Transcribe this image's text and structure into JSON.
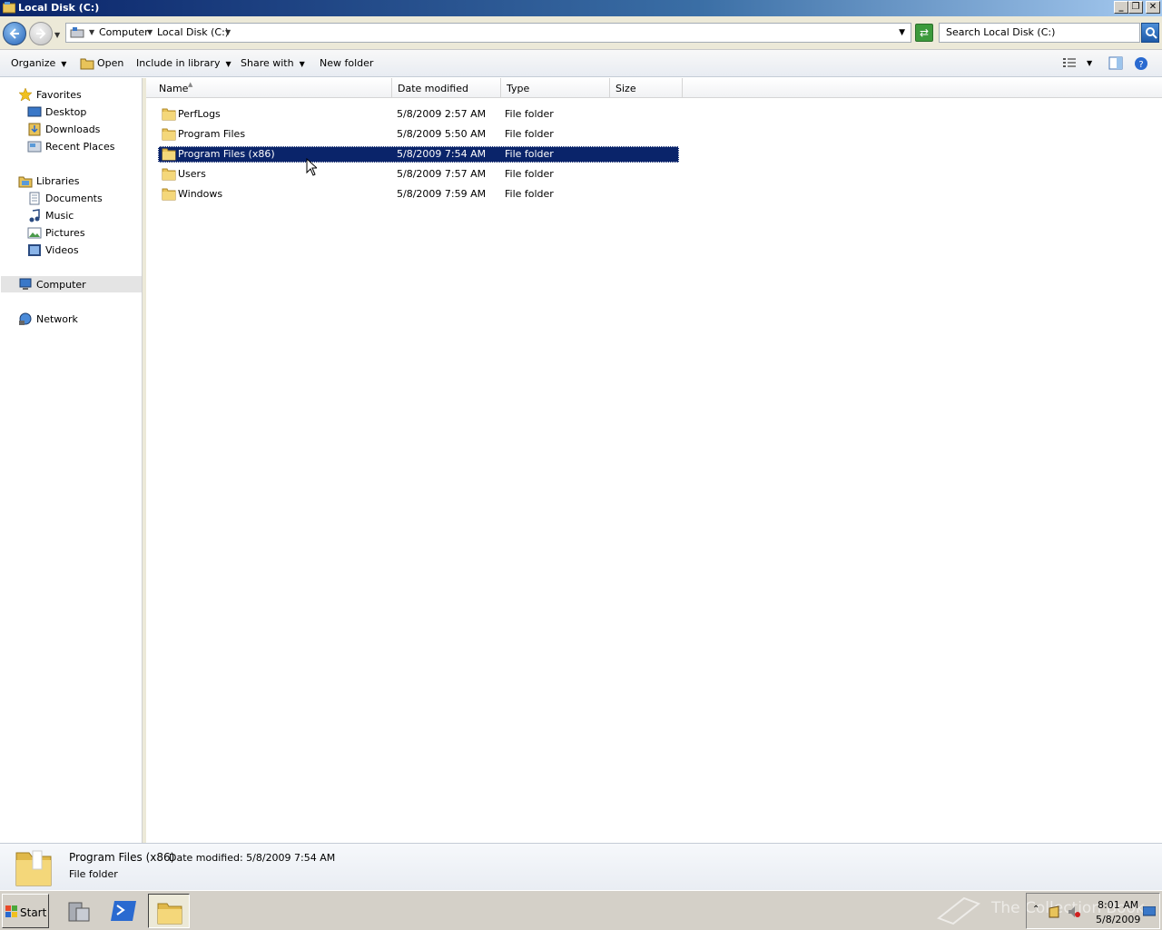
{
  "window": {
    "title": "Local Disk (C:)"
  },
  "address": {
    "crumbs": [
      "Computer",
      "Local Disk (C:)"
    ],
    "search_placeholder": "Search Local Disk (C:)"
  },
  "toolbar": {
    "organize": "Organize",
    "open": "Open",
    "include": "Include in library",
    "share": "Share with",
    "new_folder": "New folder"
  },
  "nav": {
    "favorites": "Favorites",
    "desktop": "Desktop",
    "downloads": "Downloads",
    "recent": "Recent Places",
    "libraries": "Libraries",
    "documents": "Documents",
    "music": "Music",
    "pictures": "Pictures",
    "videos": "Videos",
    "computer": "Computer",
    "network": "Network"
  },
  "columns": {
    "name": "Name",
    "date": "Date modified",
    "type": "Type",
    "size": "Size"
  },
  "files": [
    {
      "name": "PerfLogs",
      "date": "5/8/2009 2:57 AM",
      "type": "File folder"
    },
    {
      "name": "Program Files",
      "date": "5/8/2009 5:50 AM",
      "type": "File folder"
    },
    {
      "name": "Program Files (x86)",
      "date": "5/8/2009 7:54 AM",
      "type": "File folder"
    },
    {
      "name": "Users",
      "date": "5/8/2009 7:57 AM",
      "type": "File folder"
    },
    {
      "name": "Windows",
      "date": "5/8/2009 7:59 AM",
      "type": "File folder"
    }
  ],
  "details": {
    "name": "Program Files (x86)",
    "modified": "Date modified: 5/8/2009 7:54 AM",
    "type": "File folder"
  },
  "taskbar": {
    "start": "Start",
    "time": "8:01 AM",
    "date": "5/8/2009",
    "watermark": "The Collection Book"
  },
  "colors": {
    "selection": "#0a246a",
    "folder": "#e8c35a",
    "title_bar": "#0a246a"
  }
}
